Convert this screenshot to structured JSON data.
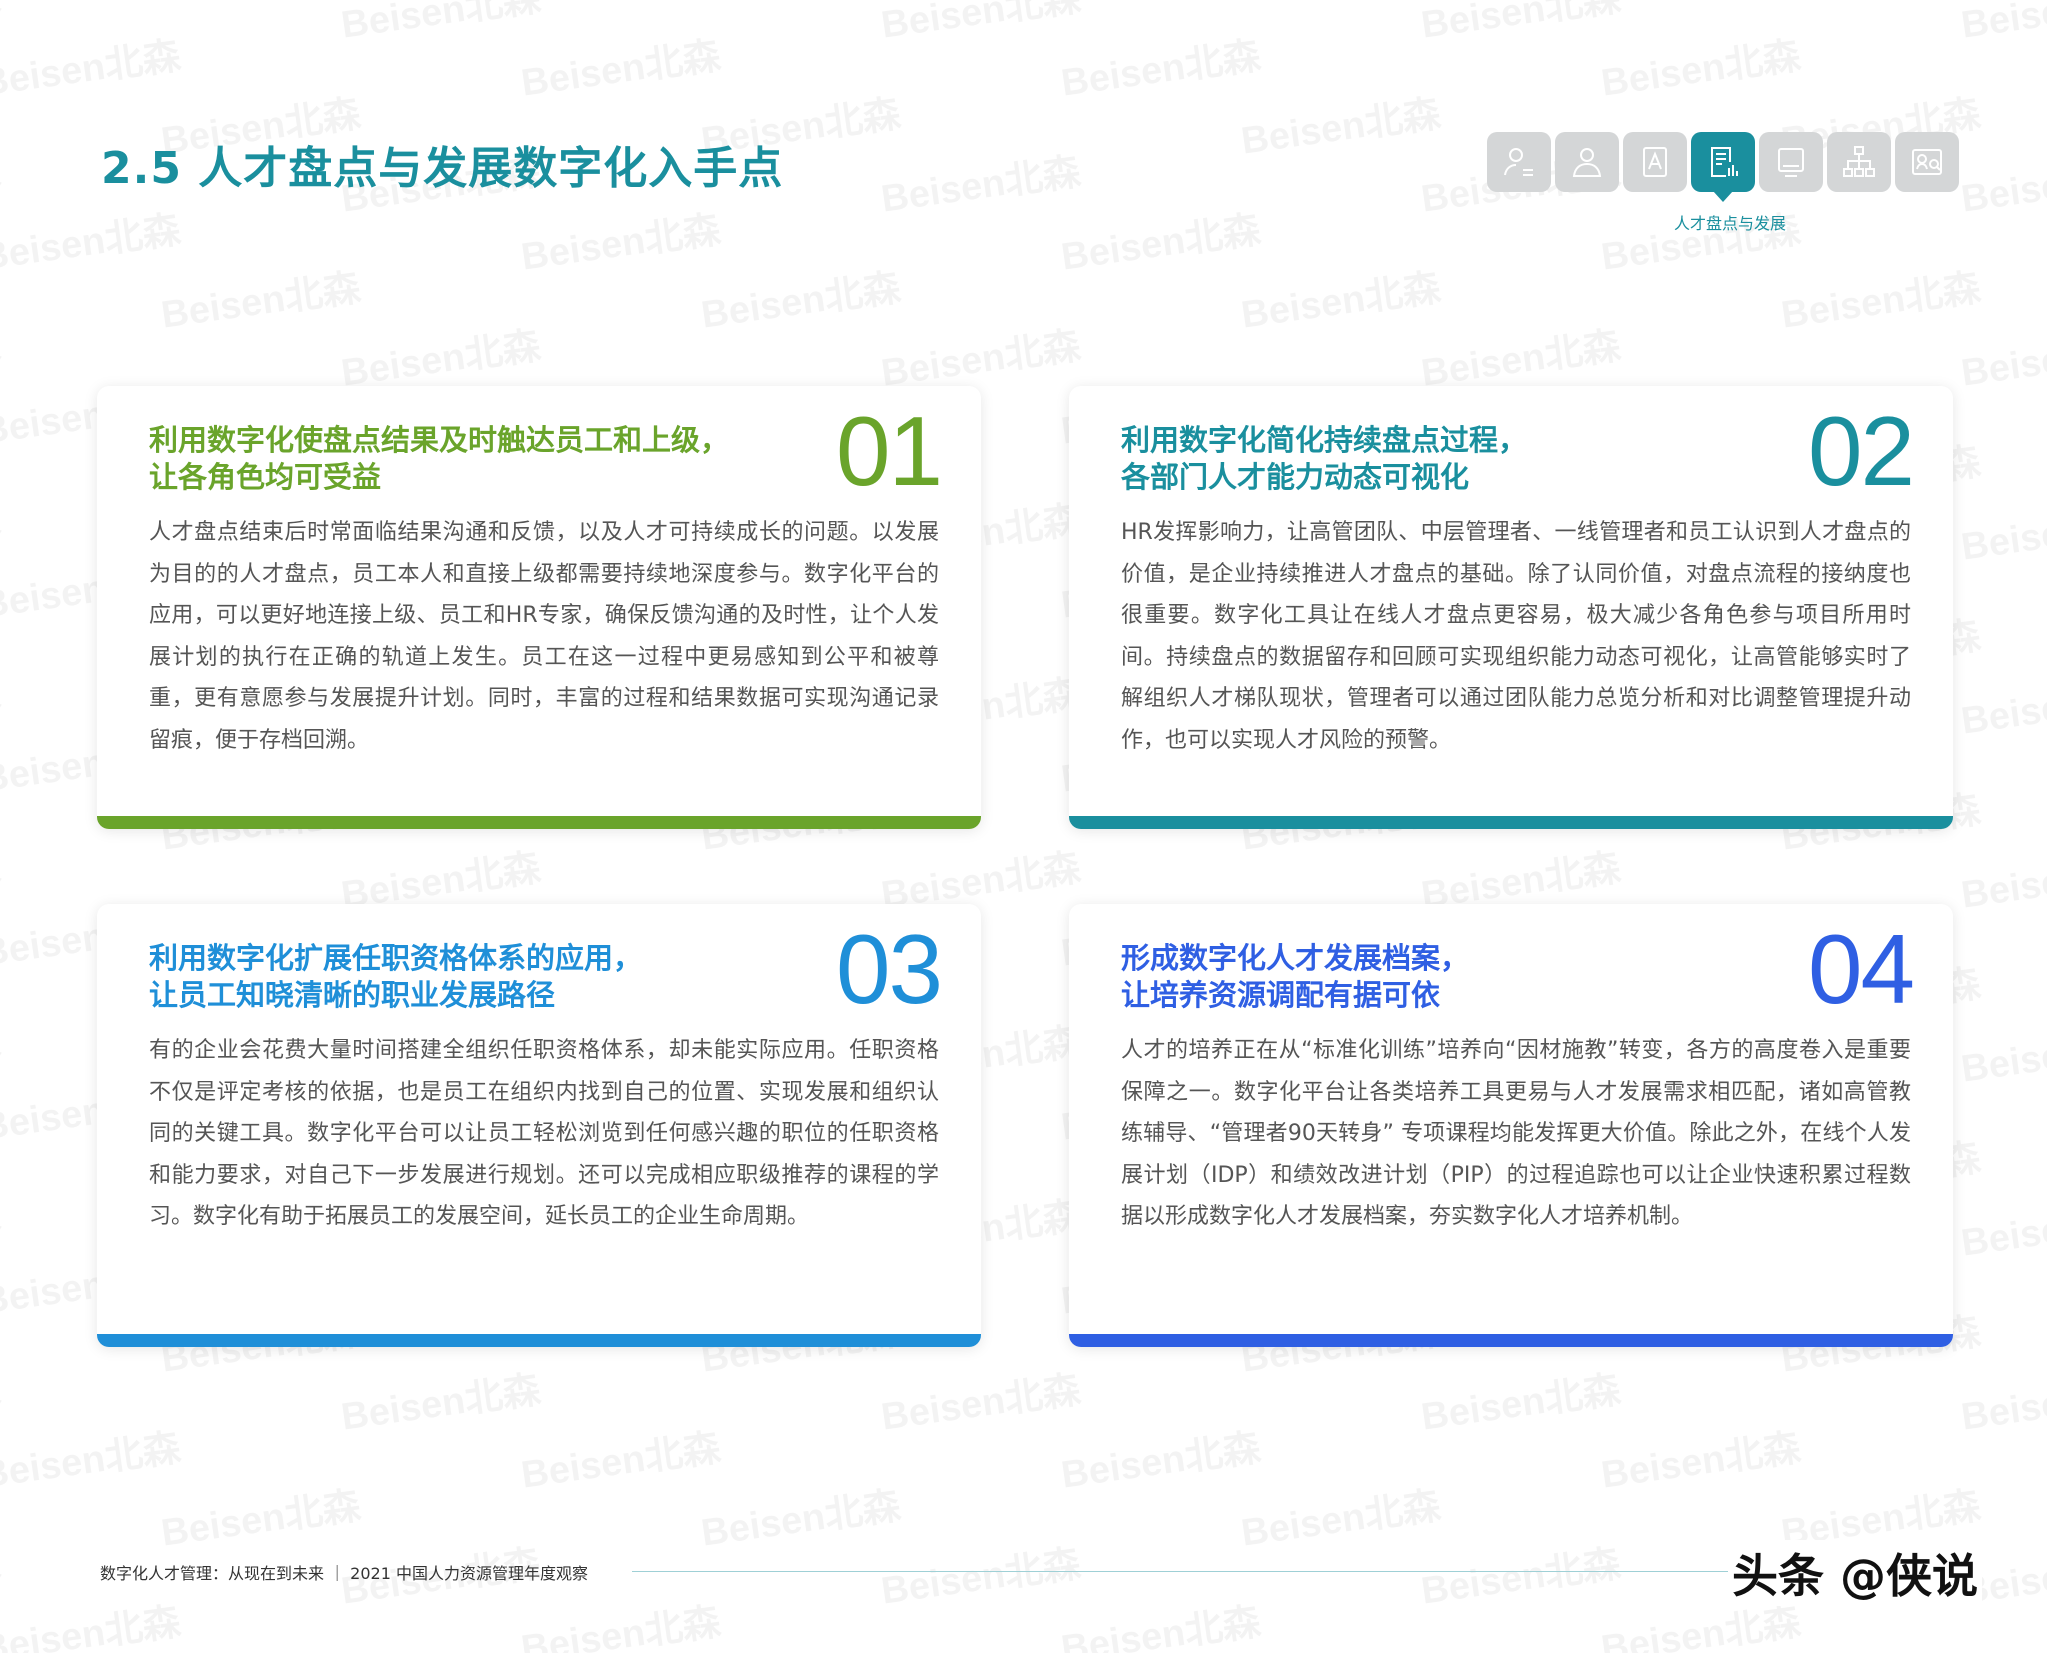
{
  "page": {
    "title": "2.5 人才盘点与发展数字化入手点",
    "watermark": "Beisen北森"
  },
  "nav": {
    "icons": [
      "person-icon",
      "user-icon",
      "assessment-icon",
      "document-chart-icon",
      "monitor-icon",
      "org-chart-icon",
      "profile-card-icon"
    ],
    "active_index": 3,
    "active_label": "人才盘点与发展",
    "active_color": "#1a8f9e",
    "inactive_color": "#d4d6d7"
  },
  "cards": [
    {
      "number": "01",
      "color": "#6aa42b",
      "title_line1": "利用数字化使盘点结果及时触达员工和上级，",
      "title_line2": "让各角色均可受益",
      "body": "人才盘点结束后时常面临结果沟通和反馈，以及人才可持续成长的问题。以发展为目的的人才盘点，员工本人和直接上级都需要持续地深度参与。数字化平台的应用，可以更好地连接上级、员工和HR专家，确保反馈沟通的及时性，让个人发展计划的执行在正确的轨道上发生。员工在这一过程中更易感知到公平和被尊重，更有意愿参与发展提升计划。同时，丰富的过程和结果数据可实现沟通记录留痕，便于存档回溯。"
    },
    {
      "number": "02",
      "color": "#1a8f9e",
      "title_line1": "利用数字化简化持续盘点过程，",
      "title_line2": "各部门人才能力动态可视化",
      "body": "HR发挥影响力，让高管团队、中层管理者、一线管理者和员工认识到人才盘点的价值，是企业持续推进人才盘点的基础。除了认同价值，对盘点流程的接纳度也很重要。数字化工具让在线人才盘点更容易，极大减少各角色参与项目所用时间。持续盘点的数据留存和回顾可实现组织能力动态可视化，让高管能够实时了解组织人才梯队现状，管理者可以通过团队能力总览分析和对比调整管理提升动作，也可以实现人才风险的预警。"
    },
    {
      "number": "03",
      "color": "#1f8fd8",
      "title_line1": "利用数字化扩展任职资格体系的应用，",
      "title_line2": "让员工知晓清晰的职业发展路径",
      "body": "有的企业会花费大量时间搭建全组织任职资格体系，却未能实际应用。任职资格不仅是评定考核的依据，也是员工在组织内找到自己的位置、实现发展和组织认同的关键工具。数字化平台可以让员工轻松浏览到任何感兴趣的职位的任职资格和能力要求，对自己下一步发展进行规划。还可以完成相应职级推荐的课程的学习。数字化有助于拓展员工的发展空间，延长员工的企业生命周期。"
    },
    {
      "number": "04",
      "color": "#2f5fe3",
      "title_line1": "形成数字化人才发展档案，",
      "title_line2": "让培养资源调配有据可依",
      "body": "人才的培养正在从“标准化训练”培养向“因材施教”转变，各方的高度卷入是重要保障之一。数字化平台让各类培养工具更易与人才发展需求相匹配，诸如高管教练辅导、“管理者90天转身” 专项课程均能发挥更大价值。除此之外，在线个人发展计划（IDP）和绩效改进计划（PIP）的过程追踪也可以让企业快速积累过程数据以形成数字化人才发展档案，夯实数字化人才培养机制。"
    }
  ],
  "footer": {
    "text": "数字化人才管理：从现在到未来 ｜ 2021 中国人力资源管理年度观察",
    "brand": "头条 @侠说"
  }
}
